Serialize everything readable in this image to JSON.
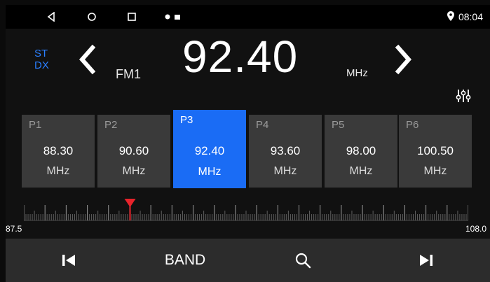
{
  "status_bar": {
    "time": "08:04",
    "icons": [
      "back-icon",
      "home-icon",
      "recents-icon",
      "notification-dot-icon",
      "gallery-icon",
      "location-pin-icon"
    ]
  },
  "radio": {
    "st_label": "ST",
    "dx_label": "DX",
    "band": "FM1",
    "frequency": "92.40",
    "unit": "MHz"
  },
  "presets": [
    {
      "name": "P1",
      "freq": "88.30",
      "unit": "MHz",
      "active": false
    },
    {
      "name": "P2",
      "freq": "90.60",
      "unit": "MHz",
      "active": false
    },
    {
      "name": "P3",
      "freq": "92.40",
      "unit": "MHz",
      "active": true
    },
    {
      "name": "P4",
      "freq": "93.60",
      "unit": "MHz",
      "active": false
    },
    {
      "name": "P5",
      "freq": "98.00",
      "unit": "MHz",
      "active": false
    },
    {
      "name": "P6",
      "freq": "100.50",
      "unit": "MHz",
      "active": false
    }
  ],
  "scale": {
    "min_label": "87.5",
    "max_label": "108.0",
    "min": 87.5,
    "max": 108.0,
    "current": 92.4
  },
  "controls": {
    "band_label": "BAND"
  },
  "colors": {
    "accent": "#1a6cf5",
    "marker": "#e8232b",
    "stdx": "#2a7fff"
  }
}
